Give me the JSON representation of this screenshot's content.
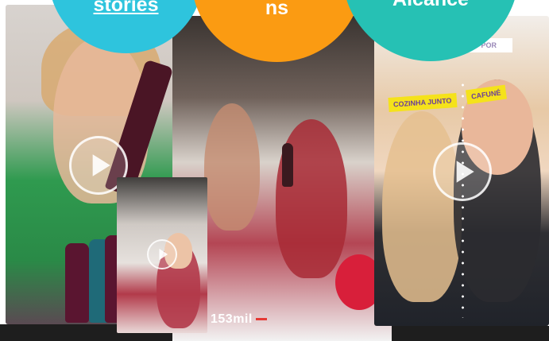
{
  "circles": [
    {
      "text": "stories",
      "color": "#2ec4dd"
    },
    {
      "text": "ns",
      "color": "#fb9b12"
    },
    {
      "text": "Alcance",
      "color": "#26c1b4"
    }
  ],
  "videos": {
    "v2": {
      "views_label": "153mil"
    },
    "v3": {
      "header": "OR · FORMADO POR",
      "tag_left": "COZINHA JUNTO",
      "tag_right": "CAFUNÉ"
    }
  },
  "colors": {
    "accent_red": "#e53935",
    "tag_yellow": "#f5e21b"
  },
  "icons": [
    "play-button-icon"
  ]
}
